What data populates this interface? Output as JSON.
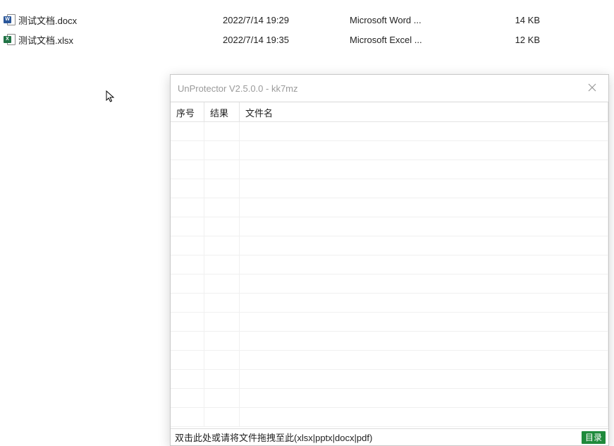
{
  "explorer": {
    "files": [
      {
        "name": "测试文档.docx",
        "date": "2022/7/14 19:29",
        "type": "Microsoft Word ...",
        "size": "14 KB",
        "iconBadge": "W",
        "iconBadgeClass": "badge-word"
      },
      {
        "name": "测试文档.xlsx",
        "date": "2022/7/14 19:35",
        "type": "Microsoft Excel ...",
        "size": "12 KB",
        "iconBadge": "X",
        "iconBadgeClass": "badge-excel"
      }
    ]
  },
  "window": {
    "title": "UnProtector V2.5.0.0 - kk7mz",
    "columns": {
      "seq": "序号",
      "result": "结果",
      "filename": "文件名"
    },
    "status_hint": "双击此处或请将文件拖拽至此(xlsx|pptx|docx|pdf)",
    "dir_button": "目录"
  }
}
